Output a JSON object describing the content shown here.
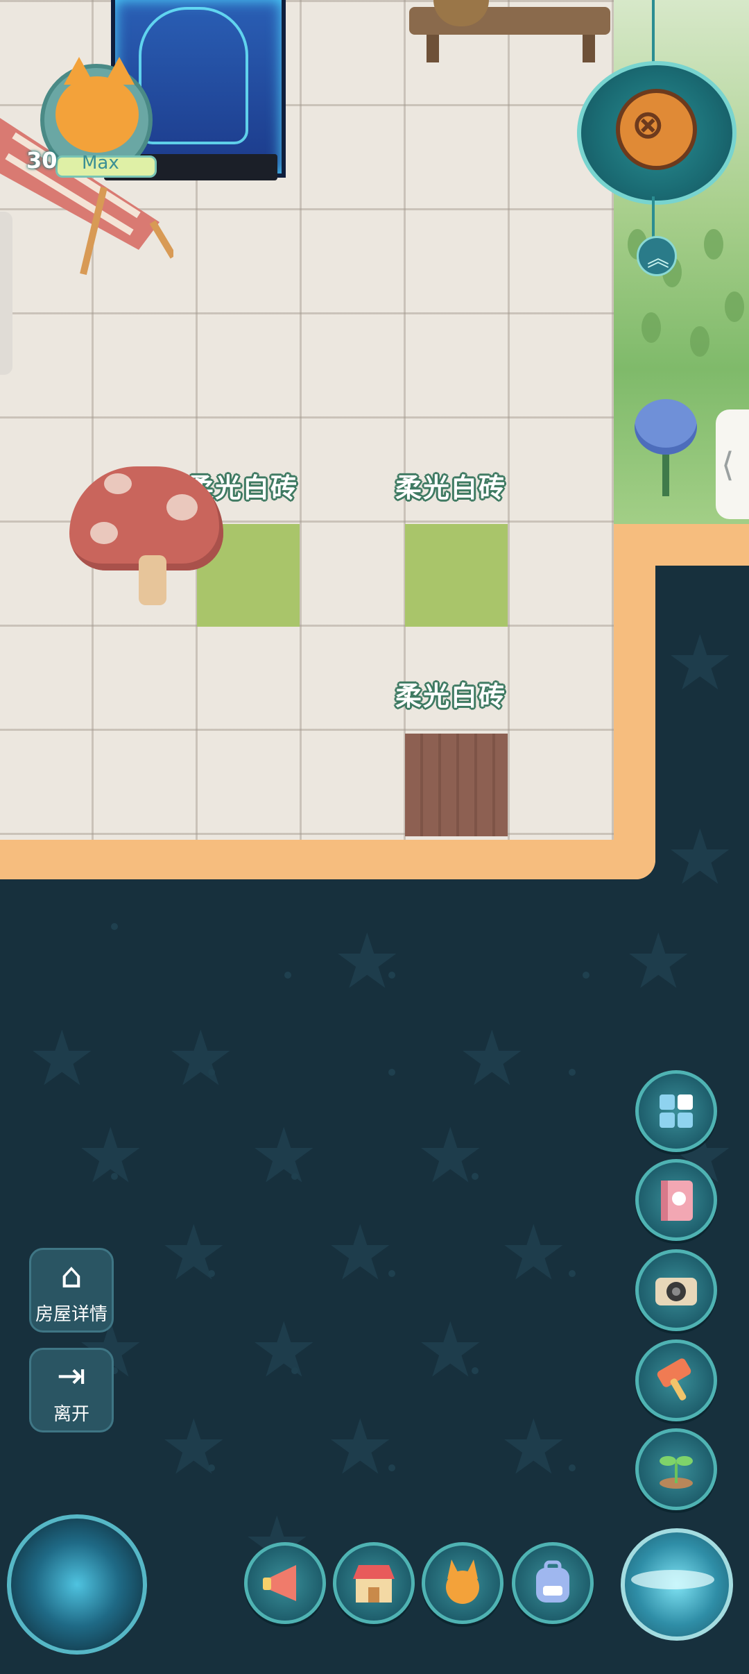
{
  "player": {
    "level": "30",
    "level_status": "Max"
  },
  "tiles": [
    {
      "label": "柔光白砖"
    },
    {
      "label": "柔光白砖"
    },
    {
      "label": "柔光白砖"
    }
  ],
  "left_buttons": {
    "house_details": "房屋详情",
    "leave": "离开"
  },
  "side_tab": {
    "arrow": "⟨"
  },
  "expand_arrow": "︽",
  "right_column_buttons": [
    {
      "icon": "layout-icon"
    },
    {
      "icon": "book-icon"
    },
    {
      "icon": "camera-icon"
    },
    {
      "icon": "hammer-icon"
    },
    {
      "icon": "sprout-icon"
    }
  ],
  "bottom_bar_buttons": [
    {
      "icon": "megaphone-icon"
    },
    {
      "icon": "shop-icon"
    },
    {
      "icon": "pet-icon"
    },
    {
      "icon": "backpack-icon"
    }
  ],
  "colors": {
    "background": "#17303d",
    "room_border": "#f6bd7e",
    "tile_green": "#a9c56a",
    "label_outline": "#3f7a62"
  }
}
